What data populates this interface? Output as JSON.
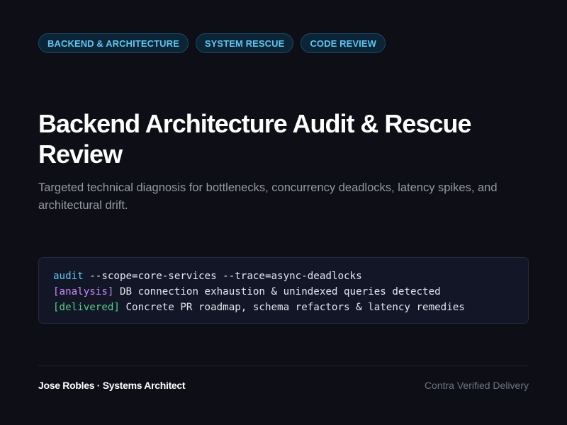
{
  "tags": [
    {
      "label": "BACKEND & ARCHITECTURE"
    },
    {
      "label": "SYSTEM RESCUE"
    },
    {
      "label": "CODE REVIEW"
    }
  ],
  "title": "Backend Architecture Audit & Rescue Review",
  "subtitle": "Targeted technical diagnosis for bottlenecks, concurrency deadlocks, latency spikes, and architectural drift.",
  "terminal": {
    "command": "audit",
    "args": " --scope=core-services --trace=async-deadlocks",
    "lines": [
      {
        "tag": "[analysis]",
        "text": " DB connection exhaustion & unindexed queries detected"
      },
      {
        "tag": "[delivered]",
        "text": " Concrete PR roadmap, schema refactors & latency remedies"
      }
    ]
  },
  "footer": {
    "author": "Jose Robles · Systems Architect",
    "verified": "Contra Verified Delivery"
  },
  "colors": {
    "background": "#0d0e16",
    "tag_text": "#5cc6f2",
    "tag_bg": "#0c2536",
    "analysis": "#c48af5",
    "delivered": "#55d08a",
    "subtitle": "#959aa8"
  }
}
